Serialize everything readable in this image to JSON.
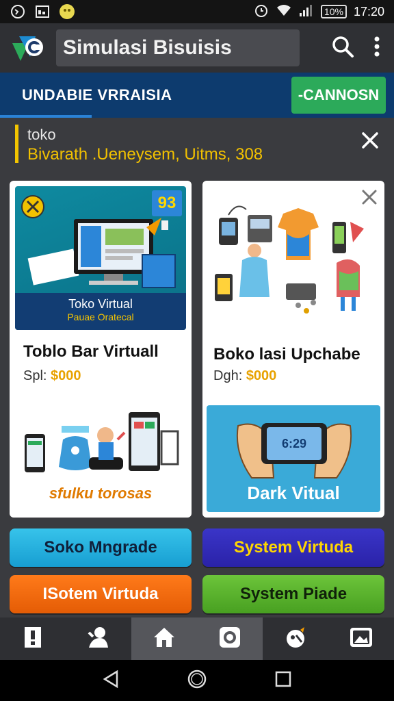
{
  "status": {
    "battery_text": "10%",
    "time": "17:20"
  },
  "app": {
    "title": "Simulasi Bisuisis"
  },
  "banner": {
    "text": "UNDABIE VRRAISIA",
    "button_label": "-CANNOSN"
  },
  "notice": {
    "line1": "toko",
    "line2": "Bivarath .Ueneysem, Uitms, 308"
  },
  "cards": [
    {
      "hero_badge": "93",
      "hero_caption_title": "Toko Virtual",
      "hero_caption_sub": "Pauae Oratecal",
      "title": "Toblo Bar Virtuall",
      "price_label": "Spl:",
      "price_value": "$000",
      "promo": "sfulku torosas"
    },
    {
      "title": "Boko lasi Upchabe",
      "price_label": "Dgh:",
      "price_value": "$000",
      "phone_time": "6:29",
      "panel_label": "Dark Vitual"
    }
  ],
  "actions": [
    {
      "label": "Soko Mngrade"
    },
    {
      "label": "System Virtuda"
    },
    {
      "label": "ISotem Virtuda"
    },
    {
      "label": "System Piade"
    }
  ],
  "tabs": [
    {
      "icon": "alert-icon"
    },
    {
      "icon": "user-icon"
    },
    {
      "icon": "home-icon"
    },
    {
      "icon": "camera-icon"
    },
    {
      "icon": "rocket-icon"
    },
    {
      "icon": "photo-icon"
    }
  ],
  "colors": {
    "banner": "#0d3b6e",
    "accent_green": "#2caa5a",
    "notice_yellow": "#f3c500"
  }
}
